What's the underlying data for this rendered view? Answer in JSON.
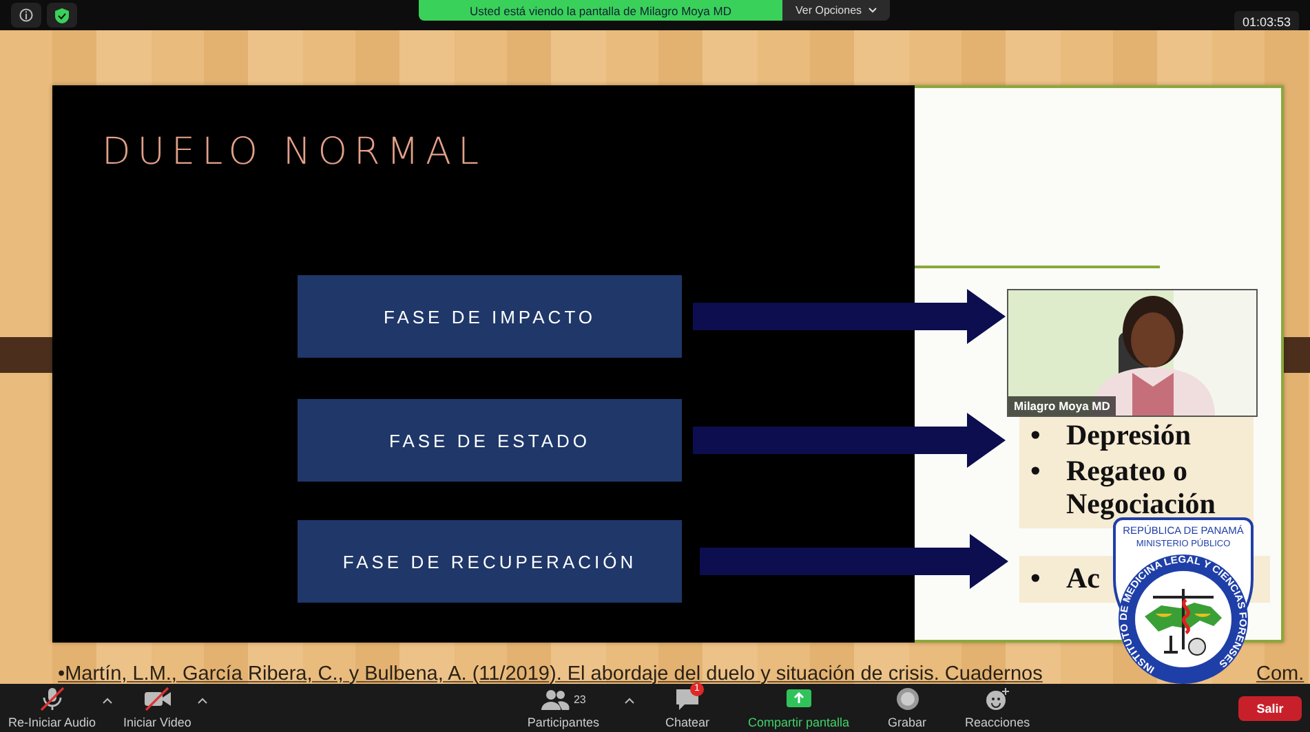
{
  "top_bar": {
    "banner": "Usted está viendo la pantalla de Milagro Moya MD",
    "view_options": "Ver Opciones",
    "timer": "01:03:53"
  },
  "slide": {
    "title": "DUELO NORMAL",
    "phases": [
      {
        "label": "FASE DE IMPACTO"
      },
      {
        "label": "FASE DE ESTADO"
      },
      {
        "label": "FASE DE RECUPERACIÓN"
      }
    ],
    "bullets": [
      {
        "marker": "•",
        "text": "Depresión"
      },
      {
        "marker": "•",
        "text": "Regateo o Negociación"
      }
    ],
    "last_bullet": {
      "marker": "•",
      "text": "Ac"
    },
    "citation": [
      "•Martín, L.M., García Ribera, C., y Bulbena, A. (11/2019). El abordaje del duelo y situación de crisis. Cuadernos",
      "Com."
    ]
  },
  "video": {
    "name": "Milagro Moya MD"
  },
  "logo": {
    "lines": [
      "REPÚBLICA DE PANAMÁ",
      "MINISTERIO PÚBLICO"
    ],
    "ring_text": "INSTITUTO DE MEDICINA LEGAL Y CIENCIAS FORENSES"
  },
  "toolbar": {
    "items": [
      {
        "kind": "audio",
        "label": "Re-Iniciar Audio",
        "muted": true
      },
      {
        "kind": "video",
        "label": "Iniciar Video",
        "muted": true
      },
      {
        "kind": "participants",
        "label": "Participantes",
        "count": "23"
      },
      {
        "kind": "chat",
        "label": "Chatear",
        "badge": "1"
      },
      {
        "kind": "share",
        "label": "Compartir pantalla"
      },
      {
        "kind": "record",
        "label": "Grabar"
      },
      {
        "kind": "reactions",
        "label": "Reacciones"
      }
    ],
    "leave": "Salir"
  }
}
